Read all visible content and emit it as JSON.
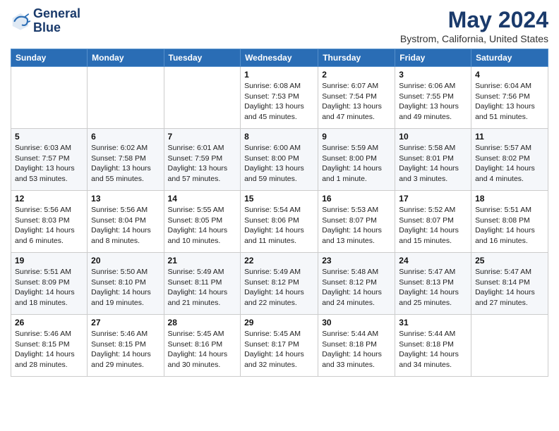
{
  "logo": {
    "line1": "General",
    "line2": "Blue"
  },
  "title": "May 2024",
  "subtitle": "Bystrom, California, United States",
  "headers": [
    "Sunday",
    "Monday",
    "Tuesday",
    "Wednesday",
    "Thursday",
    "Friday",
    "Saturday"
  ],
  "weeks": [
    [
      {
        "day": "",
        "info": ""
      },
      {
        "day": "",
        "info": ""
      },
      {
        "day": "",
        "info": ""
      },
      {
        "day": "1",
        "info": "Sunrise: 6:08 AM\nSunset: 7:53 PM\nDaylight: 13 hours\nand 45 minutes."
      },
      {
        "day": "2",
        "info": "Sunrise: 6:07 AM\nSunset: 7:54 PM\nDaylight: 13 hours\nand 47 minutes."
      },
      {
        "day": "3",
        "info": "Sunrise: 6:06 AM\nSunset: 7:55 PM\nDaylight: 13 hours\nand 49 minutes."
      },
      {
        "day": "4",
        "info": "Sunrise: 6:04 AM\nSunset: 7:56 PM\nDaylight: 13 hours\nand 51 minutes."
      }
    ],
    [
      {
        "day": "5",
        "info": "Sunrise: 6:03 AM\nSunset: 7:57 PM\nDaylight: 13 hours\nand 53 minutes."
      },
      {
        "day": "6",
        "info": "Sunrise: 6:02 AM\nSunset: 7:58 PM\nDaylight: 13 hours\nand 55 minutes."
      },
      {
        "day": "7",
        "info": "Sunrise: 6:01 AM\nSunset: 7:59 PM\nDaylight: 13 hours\nand 57 minutes."
      },
      {
        "day": "8",
        "info": "Sunrise: 6:00 AM\nSunset: 8:00 PM\nDaylight: 13 hours\nand 59 minutes."
      },
      {
        "day": "9",
        "info": "Sunrise: 5:59 AM\nSunset: 8:00 PM\nDaylight: 14 hours\nand 1 minute."
      },
      {
        "day": "10",
        "info": "Sunrise: 5:58 AM\nSunset: 8:01 PM\nDaylight: 14 hours\nand 3 minutes."
      },
      {
        "day": "11",
        "info": "Sunrise: 5:57 AM\nSunset: 8:02 PM\nDaylight: 14 hours\nand 4 minutes."
      }
    ],
    [
      {
        "day": "12",
        "info": "Sunrise: 5:56 AM\nSunset: 8:03 PM\nDaylight: 14 hours\nand 6 minutes."
      },
      {
        "day": "13",
        "info": "Sunrise: 5:56 AM\nSunset: 8:04 PM\nDaylight: 14 hours\nand 8 minutes."
      },
      {
        "day": "14",
        "info": "Sunrise: 5:55 AM\nSunset: 8:05 PM\nDaylight: 14 hours\nand 10 minutes."
      },
      {
        "day": "15",
        "info": "Sunrise: 5:54 AM\nSunset: 8:06 PM\nDaylight: 14 hours\nand 11 minutes."
      },
      {
        "day": "16",
        "info": "Sunrise: 5:53 AM\nSunset: 8:07 PM\nDaylight: 14 hours\nand 13 minutes."
      },
      {
        "day": "17",
        "info": "Sunrise: 5:52 AM\nSunset: 8:07 PM\nDaylight: 14 hours\nand 15 minutes."
      },
      {
        "day": "18",
        "info": "Sunrise: 5:51 AM\nSunset: 8:08 PM\nDaylight: 14 hours\nand 16 minutes."
      }
    ],
    [
      {
        "day": "19",
        "info": "Sunrise: 5:51 AM\nSunset: 8:09 PM\nDaylight: 14 hours\nand 18 minutes."
      },
      {
        "day": "20",
        "info": "Sunrise: 5:50 AM\nSunset: 8:10 PM\nDaylight: 14 hours\nand 19 minutes."
      },
      {
        "day": "21",
        "info": "Sunrise: 5:49 AM\nSunset: 8:11 PM\nDaylight: 14 hours\nand 21 minutes."
      },
      {
        "day": "22",
        "info": "Sunrise: 5:49 AM\nSunset: 8:12 PM\nDaylight: 14 hours\nand 22 minutes."
      },
      {
        "day": "23",
        "info": "Sunrise: 5:48 AM\nSunset: 8:12 PM\nDaylight: 14 hours\nand 24 minutes."
      },
      {
        "day": "24",
        "info": "Sunrise: 5:47 AM\nSunset: 8:13 PM\nDaylight: 14 hours\nand 25 minutes."
      },
      {
        "day": "25",
        "info": "Sunrise: 5:47 AM\nSunset: 8:14 PM\nDaylight: 14 hours\nand 27 minutes."
      }
    ],
    [
      {
        "day": "26",
        "info": "Sunrise: 5:46 AM\nSunset: 8:15 PM\nDaylight: 14 hours\nand 28 minutes."
      },
      {
        "day": "27",
        "info": "Sunrise: 5:46 AM\nSunset: 8:15 PM\nDaylight: 14 hours\nand 29 minutes."
      },
      {
        "day": "28",
        "info": "Sunrise: 5:45 AM\nSunset: 8:16 PM\nDaylight: 14 hours\nand 30 minutes."
      },
      {
        "day": "29",
        "info": "Sunrise: 5:45 AM\nSunset: 8:17 PM\nDaylight: 14 hours\nand 32 minutes."
      },
      {
        "day": "30",
        "info": "Sunrise: 5:44 AM\nSunset: 8:18 PM\nDaylight: 14 hours\nand 33 minutes."
      },
      {
        "day": "31",
        "info": "Sunrise: 5:44 AM\nSunset: 8:18 PM\nDaylight: 14 hours\nand 34 minutes."
      },
      {
        "day": "",
        "info": ""
      }
    ]
  ]
}
